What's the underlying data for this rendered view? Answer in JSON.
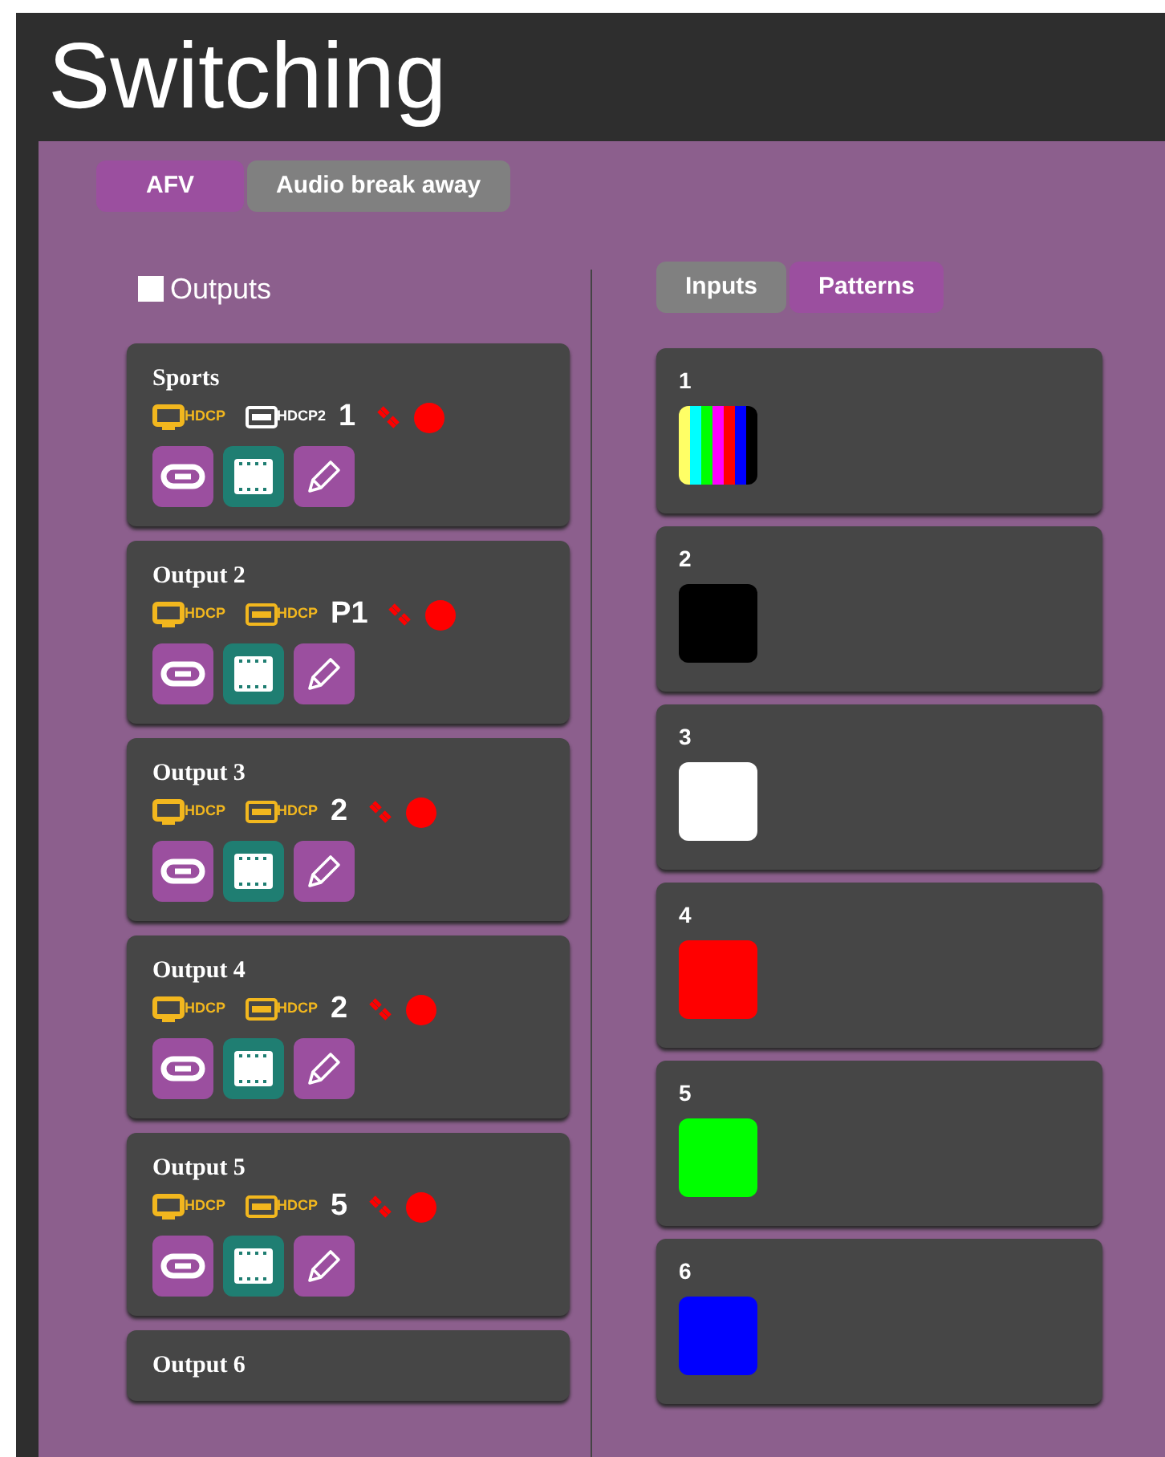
{
  "page": {
    "title": "Switching"
  },
  "mode_tabs": [
    {
      "label": "AFV",
      "selected": true
    },
    {
      "label": "Audio break away",
      "selected": false
    }
  ],
  "outputs_checkbox": {
    "label": "Outputs",
    "checked": false
  },
  "source_tabs": [
    {
      "label": "Inputs",
      "selected": false
    },
    {
      "label": "Patterns",
      "selected": true
    }
  ],
  "outputs": [
    {
      "name": "Sports",
      "output_hdcp": "HDCP",
      "input_hdcp": "HDCP2",
      "input_active": false,
      "source": "1"
    },
    {
      "name": "Output 2",
      "output_hdcp": "HDCP",
      "input_hdcp": "HDCP",
      "input_active": true,
      "source": "P1"
    },
    {
      "name": "Output 3",
      "output_hdcp": "HDCP",
      "input_hdcp": "HDCP",
      "input_active": true,
      "source": "2"
    },
    {
      "name": "Output 4",
      "output_hdcp": "HDCP",
      "input_hdcp": "HDCP",
      "input_active": true,
      "source": "2"
    },
    {
      "name": "Output 5",
      "output_hdcp": "HDCP",
      "input_hdcp": "HDCP",
      "input_active": true,
      "source": "5"
    },
    {
      "name": "Output 6"
    }
  ],
  "patterns": [
    {
      "label": "1",
      "kind": "bars"
    },
    {
      "label": "2",
      "kind": "solid",
      "color": "#000000"
    },
    {
      "label": "3",
      "kind": "solid",
      "color": "#ffffff"
    },
    {
      "label": "4",
      "kind": "solid",
      "color": "#ff0000"
    },
    {
      "label": "5",
      "kind": "solid",
      "color": "#00ff00"
    },
    {
      "label": "6",
      "kind": "solid",
      "color": "#0000ff"
    }
  ]
}
